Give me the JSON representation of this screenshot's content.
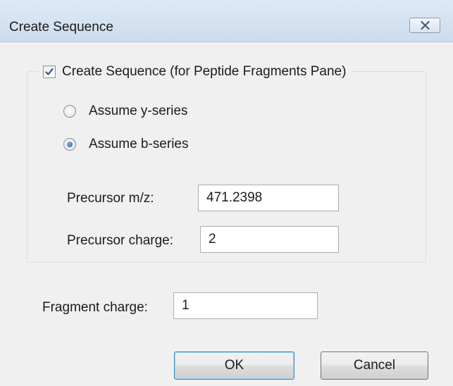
{
  "window": {
    "title": "Create Sequence"
  },
  "create_sequence": {
    "label": "Create Sequence (for Peptide Fragments Pane)",
    "checked": true,
    "series_options": [
      {
        "label": "Assume y-series",
        "selected": false
      },
      {
        "label": "Assume b-series",
        "selected": true
      }
    ],
    "precursor_mz": {
      "label": "Precursor m/z:",
      "value": "471.2398"
    },
    "precursor_charge": {
      "label": "Precursor charge:",
      "value": "2"
    }
  },
  "fragment_charge": {
    "label": "Fragment charge:",
    "value": "1"
  },
  "buttons": {
    "ok": "OK",
    "cancel": "Cancel"
  },
  "icons": {
    "close": "close-icon",
    "check": "checkmark-icon"
  },
  "colors": {
    "titlebar": "#d6e4f3",
    "dialog_bg": "#f0f0f0",
    "radio_dot": "#1e5aa8"
  }
}
